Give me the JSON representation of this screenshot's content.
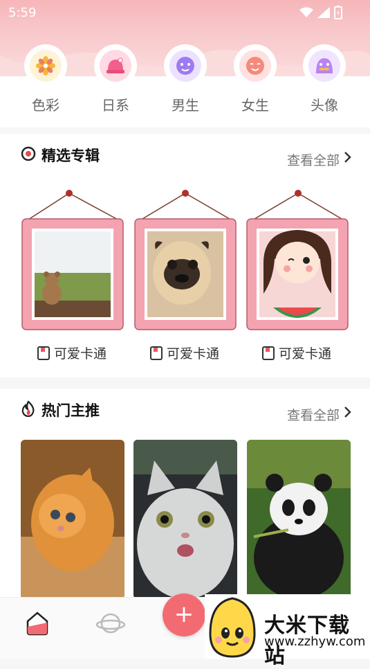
{
  "status": {
    "time": "5:59"
  },
  "categories": [
    {
      "label": "色彩",
      "icon": "flower-icon",
      "bg": "#fff3d6"
    },
    {
      "label": "日系",
      "icon": "hat-icon",
      "bg": "#ffd9e3"
    },
    {
      "label": "男生",
      "icon": "boy-face-icon",
      "bg": "#ece2ff"
    },
    {
      "label": "女生",
      "icon": "girl-face-icon",
      "bg": "#ffe1e1"
    },
    {
      "label": "头像",
      "icon": "mustache-face-icon",
      "bg": "#f1e4ff"
    }
  ],
  "featured": {
    "title": "精选专辑",
    "more": "查看全部",
    "albums": [
      {
        "caption": "可爱卡通",
        "image": "teddy-bear-window-photo"
      },
      {
        "caption": "可爱卡通",
        "image": "pug-dog-photo"
      },
      {
        "caption": "可爱卡通",
        "image": "cartoon-girl-watermelon-image"
      }
    ]
  },
  "popular": {
    "title": "热门主推",
    "more": "查看全部",
    "items": [
      {
        "image": "orange-kitten-photo"
      },
      {
        "image": "white-cat-surprised-photo"
      },
      {
        "image": "panda-eating-bamboo-photo"
      }
    ]
  },
  "nav": {
    "fab_label": "+"
  },
  "watermark": {
    "name": "大米下载站",
    "url": "www.zzhyw.com"
  },
  "colors": {
    "accent": "#f26b73",
    "header": "#f8c7ca"
  }
}
